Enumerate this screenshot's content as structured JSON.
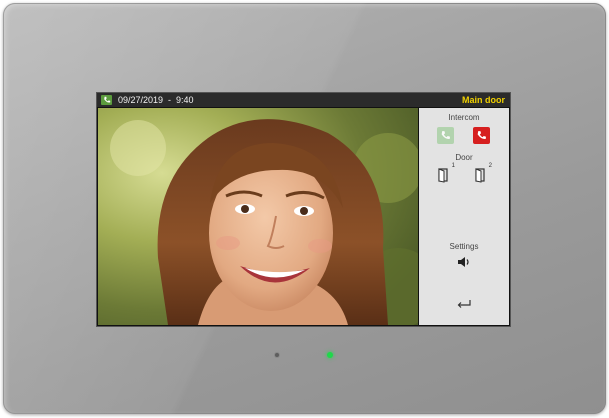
{
  "status": {
    "datetime": "09/27/2019  -  9:40",
    "location": "Main door"
  },
  "panel": {
    "intercom_label": "Intercom",
    "door_label": "Door",
    "settings_label": "Settings",
    "door1_index": "1",
    "door2_index": "2"
  },
  "colors": {
    "status_bar_bg": "#2b2b2b",
    "location_text": "#f0d000",
    "accept_button": "#a7d0a1",
    "reject_button": "#d61f1f",
    "led": "#1ed84a"
  },
  "icons": {
    "status": "phone-icon",
    "accept": "phone-icon",
    "reject": "phone-hangup-icon",
    "door1": "door-open-icon",
    "door2": "door-open-icon",
    "settings": "speaker-icon",
    "back": "back-arrow-icon"
  }
}
